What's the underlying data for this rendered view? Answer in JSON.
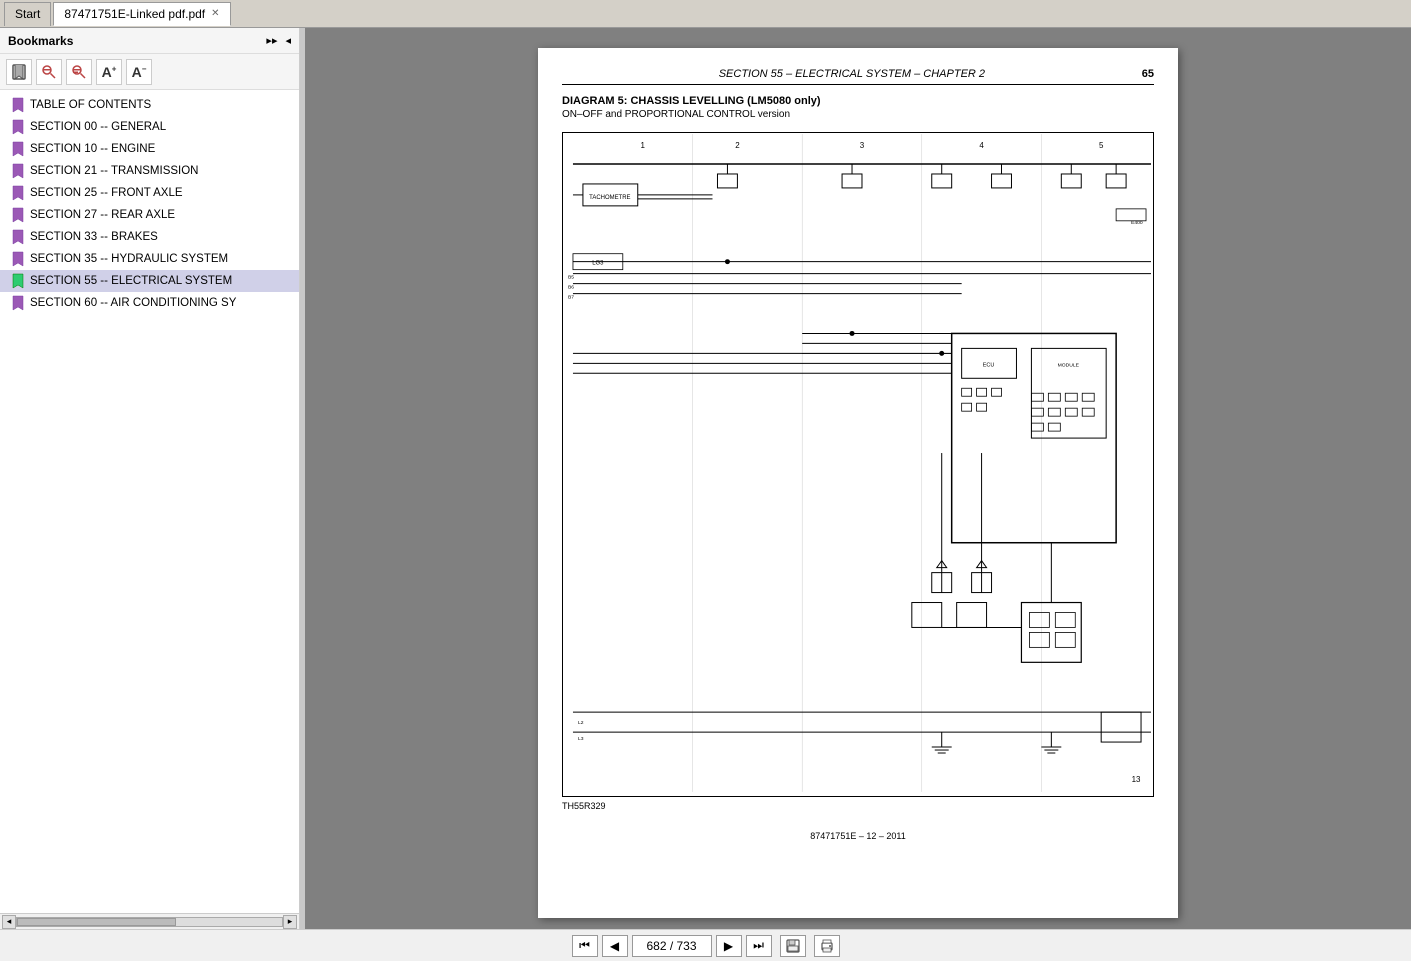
{
  "tabs": [
    {
      "id": "start",
      "label": "Start",
      "active": false,
      "closeable": false
    },
    {
      "id": "pdf",
      "label": "87471751E-Linked pdf.pdf",
      "active": true,
      "closeable": true
    }
  ],
  "sidebar": {
    "title": "Bookmarks",
    "expand_icon": "▸▸",
    "collapse_icon": "◂",
    "toolbar_icons": [
      "bookmark-view",
      "search-bookmark",
      "search-bookmark-2",
      "increase-text",
      "decrease-text"
    ],
    "items": [
      {
        "id": "toc",
        "label": "TABLE OF CONTENTS",
        "active": false,
        "color": "#9b59b6"
      },
      {
        "id": "s00",
        "label": "SECTION 00 -- GENERAL",
        "active": false,
        "color": "#9b59b6"
      },
      {
        "id": "s10",
        "label": "SECTION 10 -- ENGINE",
        "active": false,
        "color": "#9b59b6"
      },
      {
        "id": "s21",
        "label": "SECTION 21 -- TRANSMISSION",
        "active": false,
        "color": "#9b59b6"
      },
      {
        "id": "s25",
        "label": "SECTION 25 -- FRONT AXLE",
        "active": false,
        "color": "#9b59b6"
      },
      {
        "id": "s27",
        "label": "SECTION 27 -- REAR AXLE",
        "active": false,
        "color": "#9b59b6"
      },
      {
        "id": "s33",
        "label": "SECTION 33 -- BRAKES",
        "active": false,
        "color": "#9b59b6"
      },
      {
        "id": "s35",
        "label": "SECTION 35 -- HYDRAULIC SYSTEM",
        "active": false,
        "color": "#9b59b6"
      },
      {
        "id": "s55",
        "label": "SECTION 55 -- ELECTRICAL SYSTEM",
        "active": true,
        "color": "#2ecc71"
      },
      {
        "id": "s60",
        "label": "SECTION 60 -- AIR CONDITIONING SY",
        "active": false,
        "color": "#9b59b6"
      }
    ]
  },
  "pdf": {
    "header_title": "SECTION 55 – ELECTRICAL SYSTEM – CHAPTER 2",
    "page_number": "65",
    "diagram_title": "DIAGRAM 5: CHASSIS LEVELLING (LM5080 only)",
    "diagram_subtitle": "ON–OFF and PROPORTIONAL CONTROL version",
    "footer_ref": "TH55R329",
    "footer_page": "13",
    "footer_code": "87471751E – 12 – 2011"
  },
  "bottom_toolbar": {
    "first_page_label": "⏮",
    "prev_page_label": "◀",
    "page_input_value": "682 / 733",
    "next_page_label": "▶",
    "last_page_label": "⏭",
    "save_label": "💾",
    "print_label": "🖨"
  }
}
